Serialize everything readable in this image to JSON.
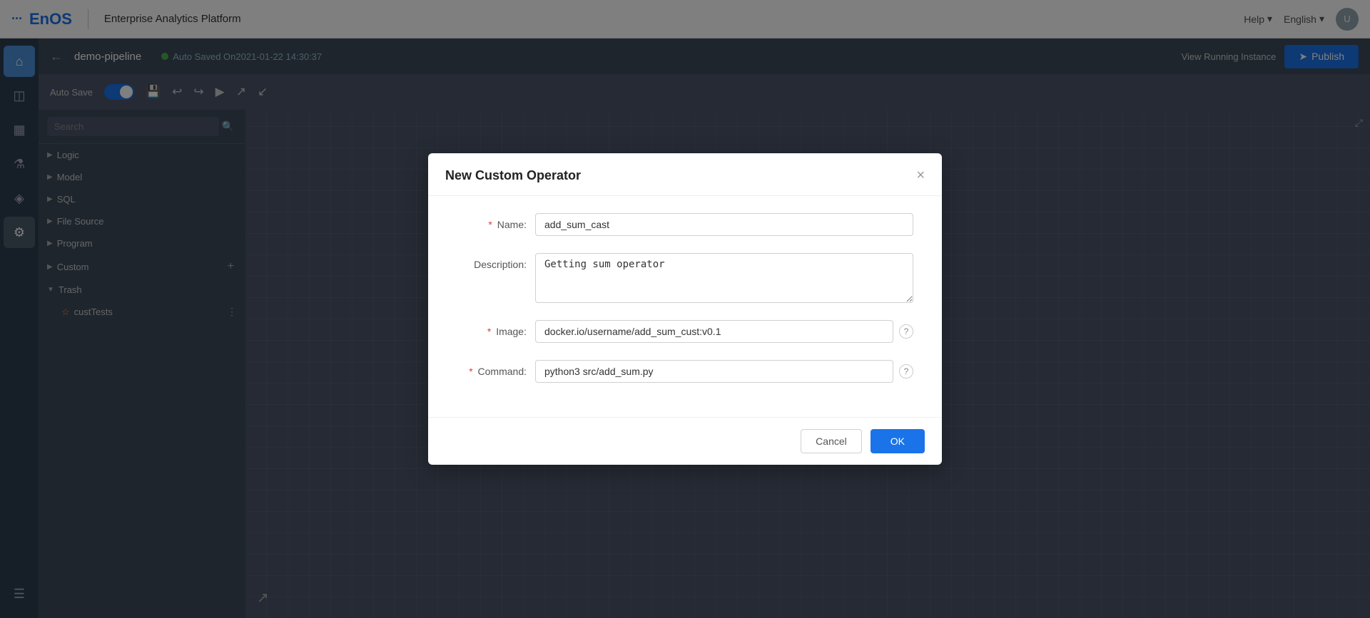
{
  "topNav": {
    "logoText": "EnOS",
    "platformName": "Enterprise Analytics Platform",
    "helpLabel": "Help",
    "langLabel": "English",
    "avatarInitial": "U"
  },
  "pipelineToolbar": {
    "backLabel": "←",
    "pipelineName": "demo-pipeline",
    "autoSavedLabel": "Auto Saved On2021-01-22 14:30:37",
    "viewRunningLabel": "View Running Instance",
    "publishLabel": "Publish"
  },
  "secondaryToolbar": {
    "autoSaveLabel": "Auto Save"
  },
  "breadcrumb": {
    "tabLabel": "demo-pip"
  },
  "leftPanel": {
    "searchPlaceholder": "Search",
    "treeItems": [
      {
        "label": "Logic",
        "expanded": false
      },
      {
        "label": "Model",
        "expanded": false
      },
      {
        "label": "SQL",
        "expanded": false
      },
      {
        "label": "File Source",
        "expanded": false
      },
      {
        "label": "Program",
        "expanded": false
      },
      {
        "label": "Custom",
        "expanded": false,
        "hasAdd": true
      },
      {
        "label": "Trash",
        "expanded": true
      }
    ],
    "custTests": {
      "label": "custTests"
    }
  },
  "modal": {
    "title": "New Custom Operator",
    "closeLabel": "×",
    "fields": {
      "name": {
        "label": "Name:",
        "required": true,
        "value": "add_sum_cast",
        "placeholder": ""
      },
      "description": {
        "label": "Description:",
        "required": false,
        "value": "Getting sum operator",
        "placeholder": ""
      },
      "image": {
        "label": "Image:",
        "required": true,
        "value": "docker.io/username/add_sum_cust:v0.1",
        "placeholder": ""
      },
      "command": {
        "label": "Command:",
        "required": true,
        "value": "python3 src/add_sum.py",
        "placeholder": ""
      }
    },
    "cancelLabel": "Cancel",
    "okLabel": "OK"
  },
  "icons": {
    "home": "⌂",
    "analytics": "◫",
    "dashboard": "▦",
    "flask": "⚗",
    "layers": "◈",
    "settings": "⚙",
    "menu": "☰",
    "search": "🔍",
    "save": "💾",
    "undo": "↩",
    "redo": "↪",
    "play": "▶",
    "export": "↗",
    "import": "↙",
    "send": "➤",
    "help": "?",
    "add": "+",
    "expand": "↗",
    "resize": "⤢"
  }
}
